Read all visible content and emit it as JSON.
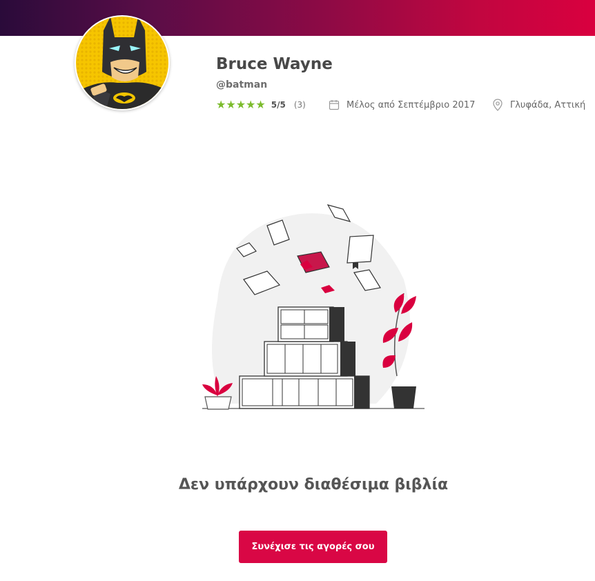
{
  "colors": {
    "accent": "#d90745",
    "rating_star": "#7bbb2c",
    "banner_start": "#2a0b3a",
    "banner_end": "#d9003f"
  },
  "profile": {
    "name": "Bruce Wayne",
    "handle": "@batman",
    "rating": {
      "stars": 5,
      "max": 5,
      "label": "5/5",
      "count_label": "(3)"
    },
    "member_since": "Μέλος από Σεπτέμβριο 2017",
    "location": "Γλυφάδα, Αττική"
  },
  "icons": {
    "calendar": "calendar-icon",
    "location": "map-pin-icon",
    "star": "star-icon"
  },
  "empty_state": {
    "title": "Δεν υπάρχουν διαθέσιμα βιβλία",
    "button_label": "Συνέχισε τις αγορές σου"
  }
}
